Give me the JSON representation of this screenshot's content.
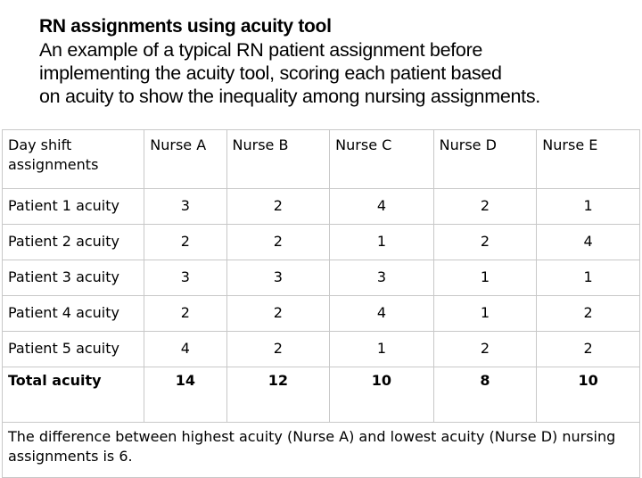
{
  "title": "RN assignments using acuity tool",
  "subtitle_lines": [
    "An example of a typical RN patient assignment before",
    "implementing the acuity tool, scoring each patient based",
    "on acuity to show the inequality among nursing assignments."
  ],
  "table": {
    "header": {
      "corner": "Day shift assignments",
      "columns": [
        "Nurse A",
        "Nurse B",
        "Nurse C",
        "Nurse D",
        "Nurse E"
      ]
    },
    "rows": [
      {
        "label": "Patient 1 acuity",
        "values": [
          "3",
          "2",
          "4",
          "2",
          "1"
        ]
      },
      {
        "label": "Patient 2 acuity",
        "values": [
          "2",
          "2",
          "1",
          "2",
          "4"
        ]
      },
      {
        "label": "Patient 3 acuity",
        "values": [
          "3",
          "3",
          "3",
          "1",
          "1"
        ]
      },
      {
        "label": "Patient 4 acuity",
        "values": [
          "2",
          "2",
          "4",
          "1",
          "2"
        ]
      },
      {
        "label": "Patient 5 acuity",
        "values": [
          "4",
          "2",
          "1",
          "2",
          "2"
        ]
      }
    ],
    "total": {
      "label": "Total acuity",
      "values": [
        "14",
        "12",
        "10",
        "8",
        "10"
      ]
    },
    "note": "The difference between highest acuity (Nurse A) and lowest acuity (Nurse D) nursing assignments is 6."
  }
}
